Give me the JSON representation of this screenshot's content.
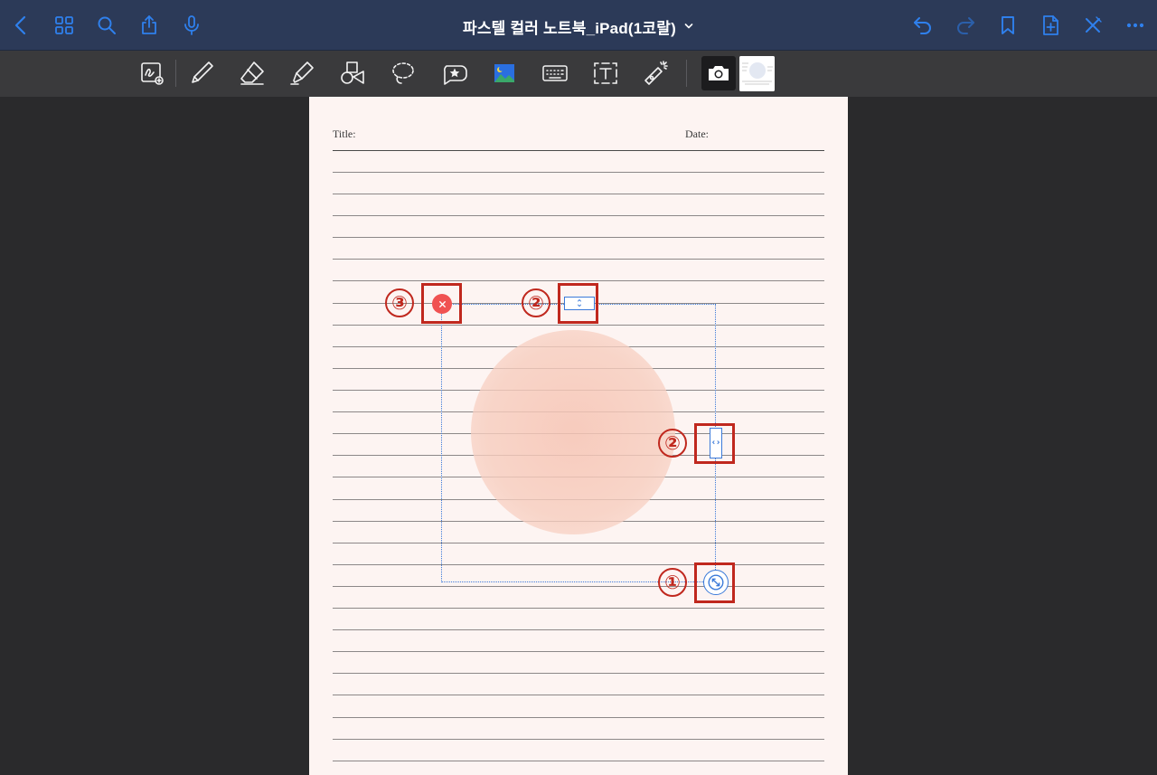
{
  "header": {
    "title": "파스텔 컬러 노트북_iPad(1코랄)"
  },
  "page": {
    "title_label": "Title:",
    "date_label": "Date:"
  },
  "annotations": [
    {
      "id": "1",
      "label": "①"
    },
    {
      "id": "2a",
      "label": "②"
    },
    {
      "id": "2b",
      "label": "②"
    },
    {
      "id": "3",
      "label": "③"
    }
  ],
  "colors": {
    "accent": "#2f80ed",
    "topbar": "#2c3a58",
    "toolbar": "#3a3a3c",
    "page": "#fdf4f2",
    "callout": "#c0281e",
    "delete": "#f05252",
    "circle": "#f6c4b4"
  },
  "icons": {
    "top_left": [
      "back-icon",
      "grid-icon",
      "search-icon",
      "share-icon",
      "microphone-icon"
    ],
    "top_right": [
      "undo-icon",
      "redo-icon",
      "bookmark-icon",
      "add-page-icon",
      "close-icon",
      "more-icon"
    ],
    "tools": [
      "zoom-pen-icon",
      "pen-icon",
      "eraser-icon",
      "highlighter-icon",
      "shapes-icon",
      "lasso-icon",
      "sticker-icon",
      "image-icon",
      "keyboard-icon",
      "text-box-icon",
      "laser-pointer-icon",
      "camera-icon"
    ]
  }
}
